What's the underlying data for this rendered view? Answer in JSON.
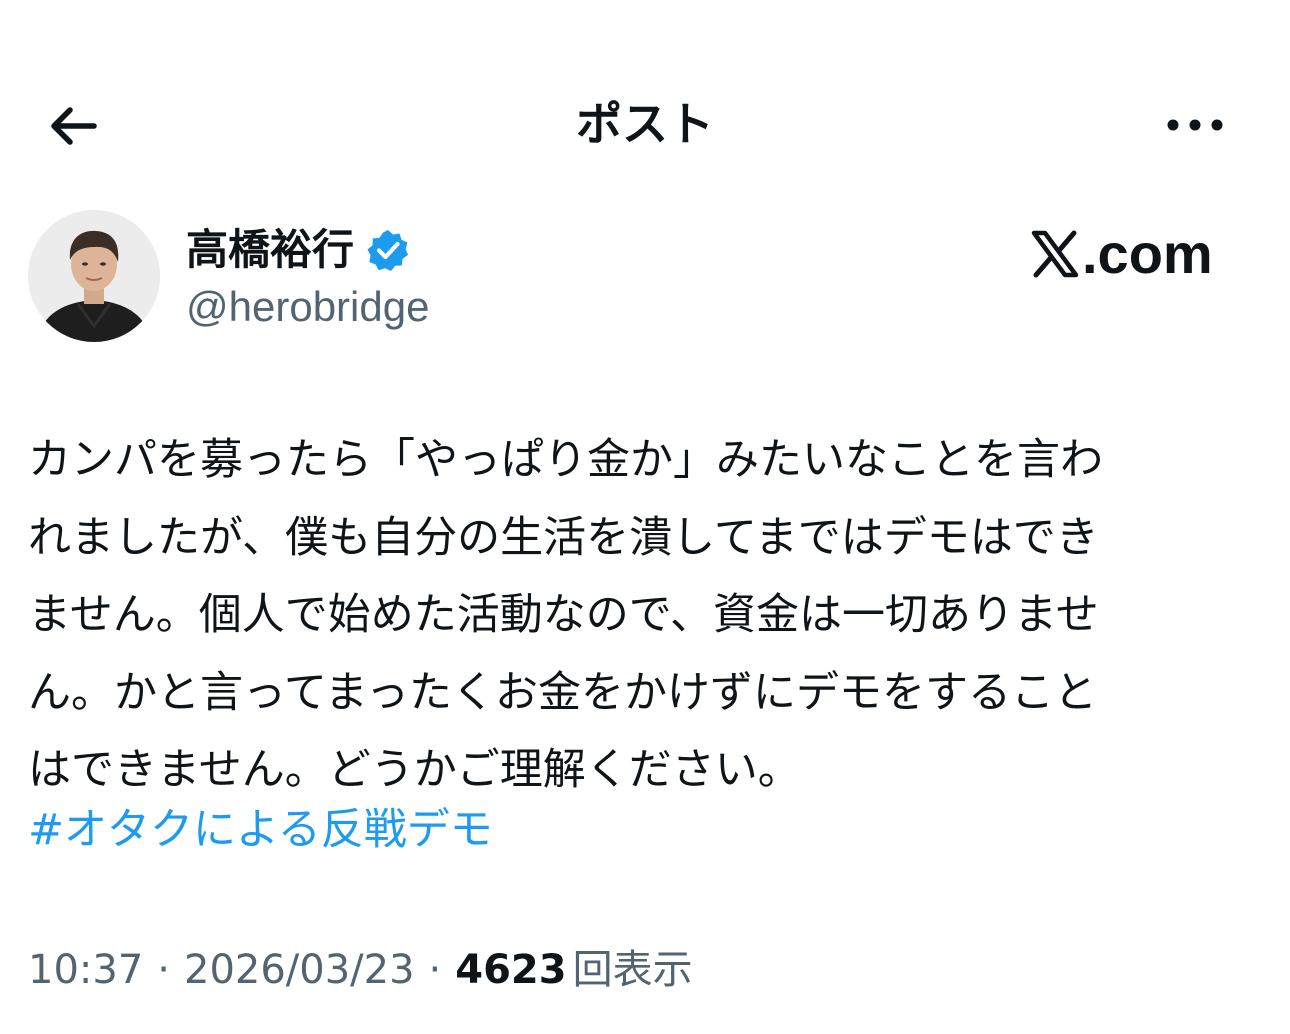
{
  "header": {
    "back_icon": "arrow-left-icon",
    "title": "ポスト",
    "more_icon": "more-horizontal-icon"
  },
  "author": {
    "display_name": "高橋裕行",
    "verified": true,
    "verified_color": "#1d9bf0",
    "handle": "@herobridge"
  },
  "brand": {
    "text": ".com",
    "logo_icon": "x-logo-icon"
  },
  "post": {
    "lines": [
      "カンパを募ったら「やっぱり金か」みたいなことを言わ",
      "れましたが、僕も自分の生活を潰してまではデモはでき",
      "ません。個人で始めた活動なので、資金は一切ありませ",
      "ん。かと言ってまったくお金をかけずにデモをすること",
      "はできません。どうかご理解ください。"
    ],
    "hashtag": "#オタクによる反戦デモ",
    "hashtag_color": "#1d9bf0"
  },
  "meta": {
    "time": "10:37",
    "separator": "·",
    "date": "2026/03/23",
    "views_count": "4623",
    "views_label": "回表示"
  },
  "colors": {
    "text_primary": "#0f1419",
    "text_secondary": "#536471",
    "accent": "#1d9bf0",
    "background": "#ffffff"
  }
}
